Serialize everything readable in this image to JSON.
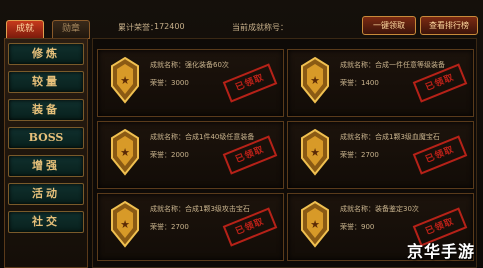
{
  "tabs": [
    {
      "label": "成就",
      "active": true
    },
    {
      "label": "勋章",
      "active": false
    }
  ],
  "header": {
    "total_honor_label": "累计荣誉：",
    "total_honor_value": "172400",
    "current_title_label": "当前成就称号："
  },
  "buttons": {
    "claim_all": "一键领取",
    "view_ranking": "查看排行榜"
  },
  "sidebar": {
    "items": [
      {
        "label": "修炼",
        "name": "sidebar-item-cultivate"
      },
      {
        "label": "较量",
        "name": "sidebar-item-duel"
      },
      {
        "label": "装备",
        "name": "sidebar-item-equipment"
      },
      {
        "label": "BOSS",
        "name": "sidebar-item-boss"
      },
      {
        "label": "增强",
        "name": "sidebar-item-enhance"
      },
      {
        "label": "活动",
        "name": "sidebar-item-activity"
      },
      {
        "label": "社交",
        "name": "sidebar-item-social"
      }
    ]
  },
  "achievements": [
    {
      "name_label": "成就名称：",
      "name": "强化装备60次",
      "honor_label": "荣誉：",
      "honor": "3000",
      "stamp": "已领取"
    },
    {
      "name_label": "成就名称：",
      "name": "合成一件任意等级装备",
      "honor_label": "荣誉：",
      "honor": "1400",
      "stamp": "已领取"
    },
    {
      "name_label": "成就名称：",
      "name": "合成1件40级任意装备",
      "honor_label": "荣誉：",
      "honor": "2000",
      "stamp": "已领取"
    },
    {
      "name_label": "成就名称：",
      "name": "合成1颗3级血魔宝石",
      "honor_label": "荣誉：",
      "honor": "2700",
      "stamp": "已领取"
    },
    {
      "name_label": "成就名称：",
      "name": "合成1颗3级攻击宝石",
      "honor_label": "荣誉：",
      "honor": "2700",
      "stamp": "已领取"
    },
    {
      "name_label": "成就名称：",
      "name": "装备鉴定30次",
      "honor_label": "荣誉：",
      "honor": "900",
      "stamp": "已领取"
    }
  ],
  "watermark": "京华手游",
  "colors": {
    "accent": "#c73a1c",
    "gold": "#e6c07a",
    "stamp_red": "#d0231a"
  }
}
